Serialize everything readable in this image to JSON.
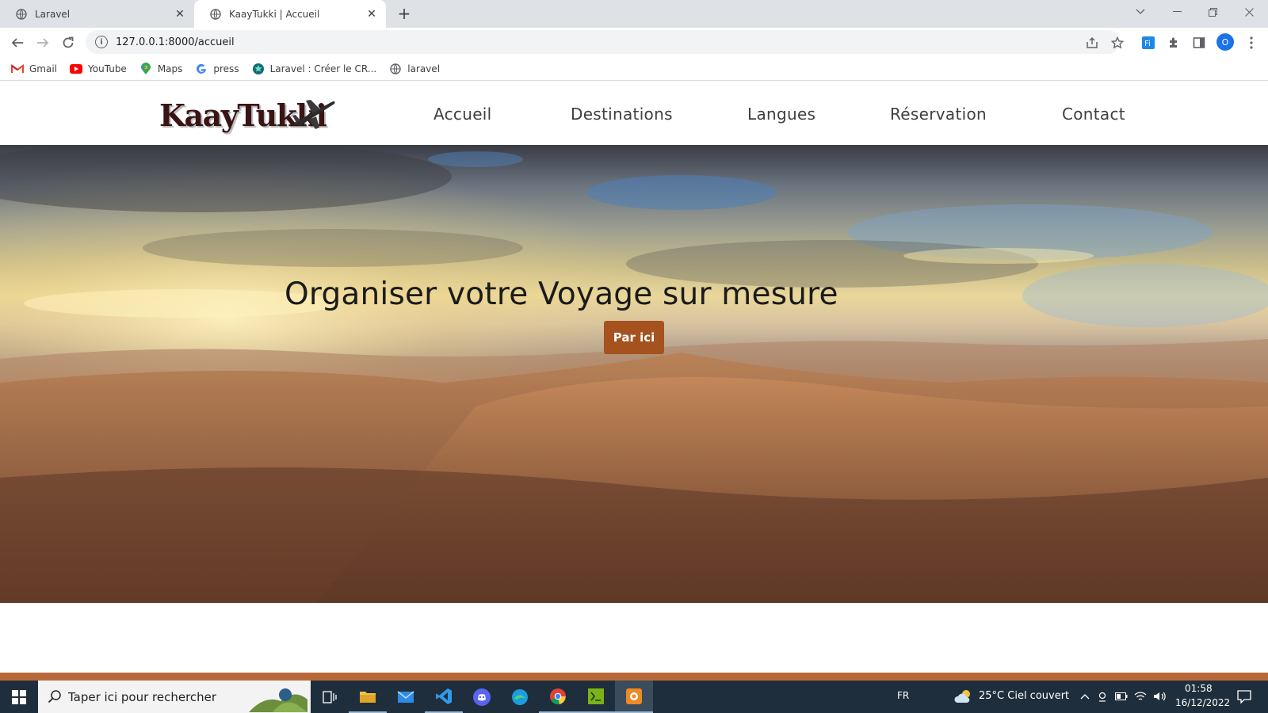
{
  "browser": {
    "tabs": [
      {
        "title": "Laravel",
        "active": false
      },
      {
        "title": "KaayTukki | Accueil",
        "active": true
      }
    ],
    "address": "127.0.0.1:8000/accueil",
    "profile_initial": "O",
    "bookmarks": [
      {
        "label": "Gmail",
        "icon": "gmail-icon"
      },
      {
        "label": "YouTube",
        "icon": "youtube-icon"
      },
      {
        "label": "Maps",
        "icon": "maps-icon"
      },
      {
        "label": "press",
        "icon": "google-icon"
      },
      {
        "label": "Laravel : Créer le CR...",
        "icon": "globe-icon"
      },
      {
        "label": "laravel",
        "icon": "globe-icon"
      }
    ]
  },
  "site": {
    "logo_text": "KaayTukki",
    "nav": [
      "Accueil",
      "Destinations",
      "Langues",
      "Réservation",
      "Contact"
    ],
    "hero_title": "Organiser votre Voyage sur mesure",
    "hero_button": "Par ici",
    "colors": {
      "accent": "#a5521f",
      "footer_strip": "#b9683a"
    }
  },
  "taskbar": {
    "search_placeholder": "Taper ici pour rechercher",
    "language": "FR",
    "weather": "25°C  Ciel couvert",
    "time": "01:58",
    "date": "16/12/2022"
  }
}
